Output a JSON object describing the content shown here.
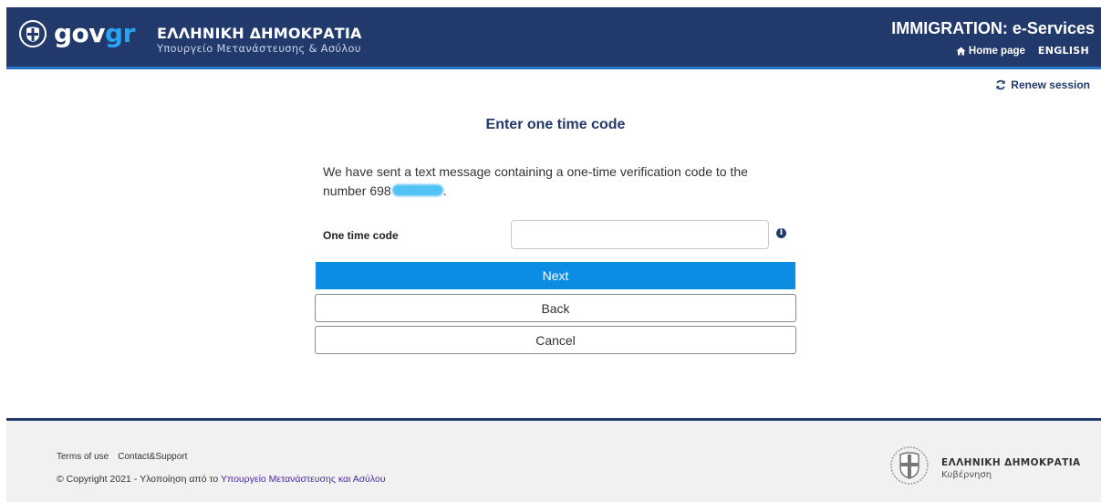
{
  "header": {
    "logo_word_1": "gov",
    "logo_word_2": "gr",
    "ministry_title": "ΕΛΛΗΝΙΚΗ ΔΗΜΟΚΡΑΤΙΑ",
    "ministry_subtitle": "Υπουργείο Μετανάστευσης & Ασύλου",
    "app_title": "IMMIGRATION: e-Services",
    "home_link": "Home page",
    "language_link": "ENGLISH"
  },
  "session": {
    "renew_label": "Renew session"
  },
  "form": {
    "heading": "Enter one time code",
    "message": "We have sent a text message containing a one-time verification code to the number 698",
    "message_end": ".",
    "code_label": "One time code",
    "code_value": "",
    "info_glyph": "i",
    "next_label": "Next",
    "back_label": "Back",
    "cancel_label": "Cancel"
  },
  "footer": {
    "terms_label": "Terms of use",
    "contact_label": "Contact&Support",
    "copyright_prefix": "© Copyright 2021 - Υλοποίηση από το",
    "copyright_ministry": "Υπουργείο Μετανάστευσης και Ασύλου",
    "gov_title": "ΕΛΛΗΝΙΚΗ ΔΗΜΟΚΡΑΤΙΑ",
    "gov_subtitle": "Κυβέρνηση"
  },
  "colors": {
    "header_bg": "#213a6b",
    "accent_blue": "#0c8de4",
    "logo_gr": "#2aa3f0"
  },
  "icons": {
    "logo": "greek-emblem-icon",
    "home": "home-icon",
    "renew": "refresh-icon",
    "info": "info-icon",
    "footer_emblem": "greek-coat-of-arms-icon"
  }
}
